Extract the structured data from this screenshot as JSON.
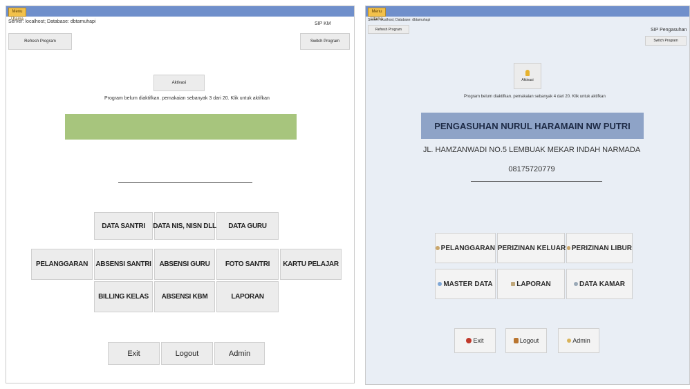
{
  "left": {
    "title_badge": "Menu Utama",
    "server_text": "Server: localhost; Database: dbtamuhapi",
    "version": "SIP KM",
    "refresh_label": "Refresh Program",
    "switch_label": "Switch Program",
    "activate_label": "Aktivasi",
    "notice": "Program belum diaktifkan. pemakaian sebanyak 3 dari 20. Klik untuk aktifkan",
    "menu": {
      "data_santri": "DATA SANTRI",
      "data_nis": "DATA NIS, NISN DLL",
      "data_guru": "DATA GURU",
      "pelanggaran": "PELANGGARAN",
      "absensi_santri": "ABSENSI SANTRI",
      "absensi_guru": "ABSENSI GURU",
      "foto_santri": "FOTO SANTRI",
      "kartu_pelajar": "KARTU PELAJAR",
      "billing_kelas": "BILLING KELAS",
      "absensi_kbm": "ABSENSI KBM",
      "laporan": "LAPORAN"
    },
    "footer": {
      "exit": "Exit",
      "logout": "Logout",
      "admin": "Admin"
    },
    "colors": {
      "status_strip": "#a7c57d",
      "titlebar": "#6f8fcb"
    }
  },
  "right": {
    "title_badge": "Menu Utama",
    "server_text": "Server: localhost; Database: dbtamuhapi",
    "version": "SIP Pengasuhan",
    "refresh_label": "Refresh Program",
    "switch_label": "Switch Program",
    "activate_label": "Aktivasi",
    "notice": "Program belum diaktifkan. pemakaian sebanyak 4 dari 20. Klik untuk aktifkan",
    "institution": "PENGASUHAN NURUL HARAMAIN NW PUTRI",
    "address": "JL. HAMZANWADI NO.5 LEMBUAK MEKAR INDAH NARMADA",
    "phone": "08175720779",
    "menu": {
      "pelanggaran": "PELANGGARAN",
      "perizinan_keluar": "PERIZINAN KELUAR",
      "perizinan_libur": "PERIZINAN LIBUR",
      "master_data": "MASTER DATA",
      "laporan": "LAPORAN",
      "data_kamar": "DATA KAMAR"
    },
    "footer": {
      "exit": "Exit",
      "logout": "Logout",
      "admin": "Admin"
    },
    "icons": [
      "bulb-icon",
      "exit-icon",
      "logout-icon",
      "admin-icon"
    ],
    "colors": {
      "banner": "#8ea3c7",
      "background": "#e9eef5",
      "titlebar": "#6f8fcb"
    }
  }
}
